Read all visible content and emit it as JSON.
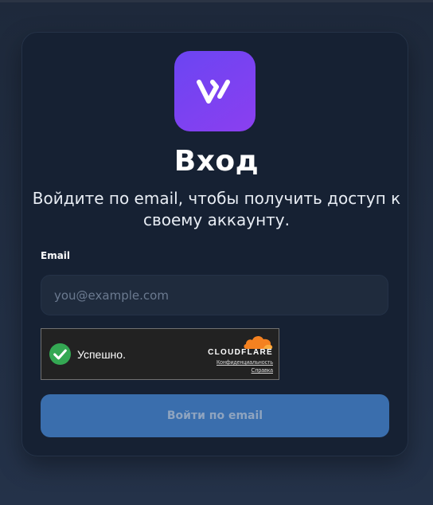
{
  "app": {
    "logo_icon": "w-logo-icon",
    "logo_gradient": [
      "#6b45f2",
      "#8b3ff0"
    ]
  },
  "login": {
    "title": "Вход",
    "subtitle": "Войдите по email, чтобы получить доступ к своему аккаунту.",
    "email_label": "Email",
    "email_placeholder": "you@example.com",
    "email_value": "",
    "submit_label": "Войти по email"
  },
  "captcha": {
    "status": "Успешно.",
    "status_icon": "check-circle-icon",
    "brand": "CLOUDFLARE",
    "brand_icon": "cloudflare-cloud-icon",
    "privacy_link": "Конфиденциальность",
    "help_link": "Справка"
  },
  "colors": {
    "background": "#1e293b",
    "card": "#162133",
    "button": "#3a6ead",
    "success": "#34a853",
    "cloudflare_orange": "#f48120"
  }
}
